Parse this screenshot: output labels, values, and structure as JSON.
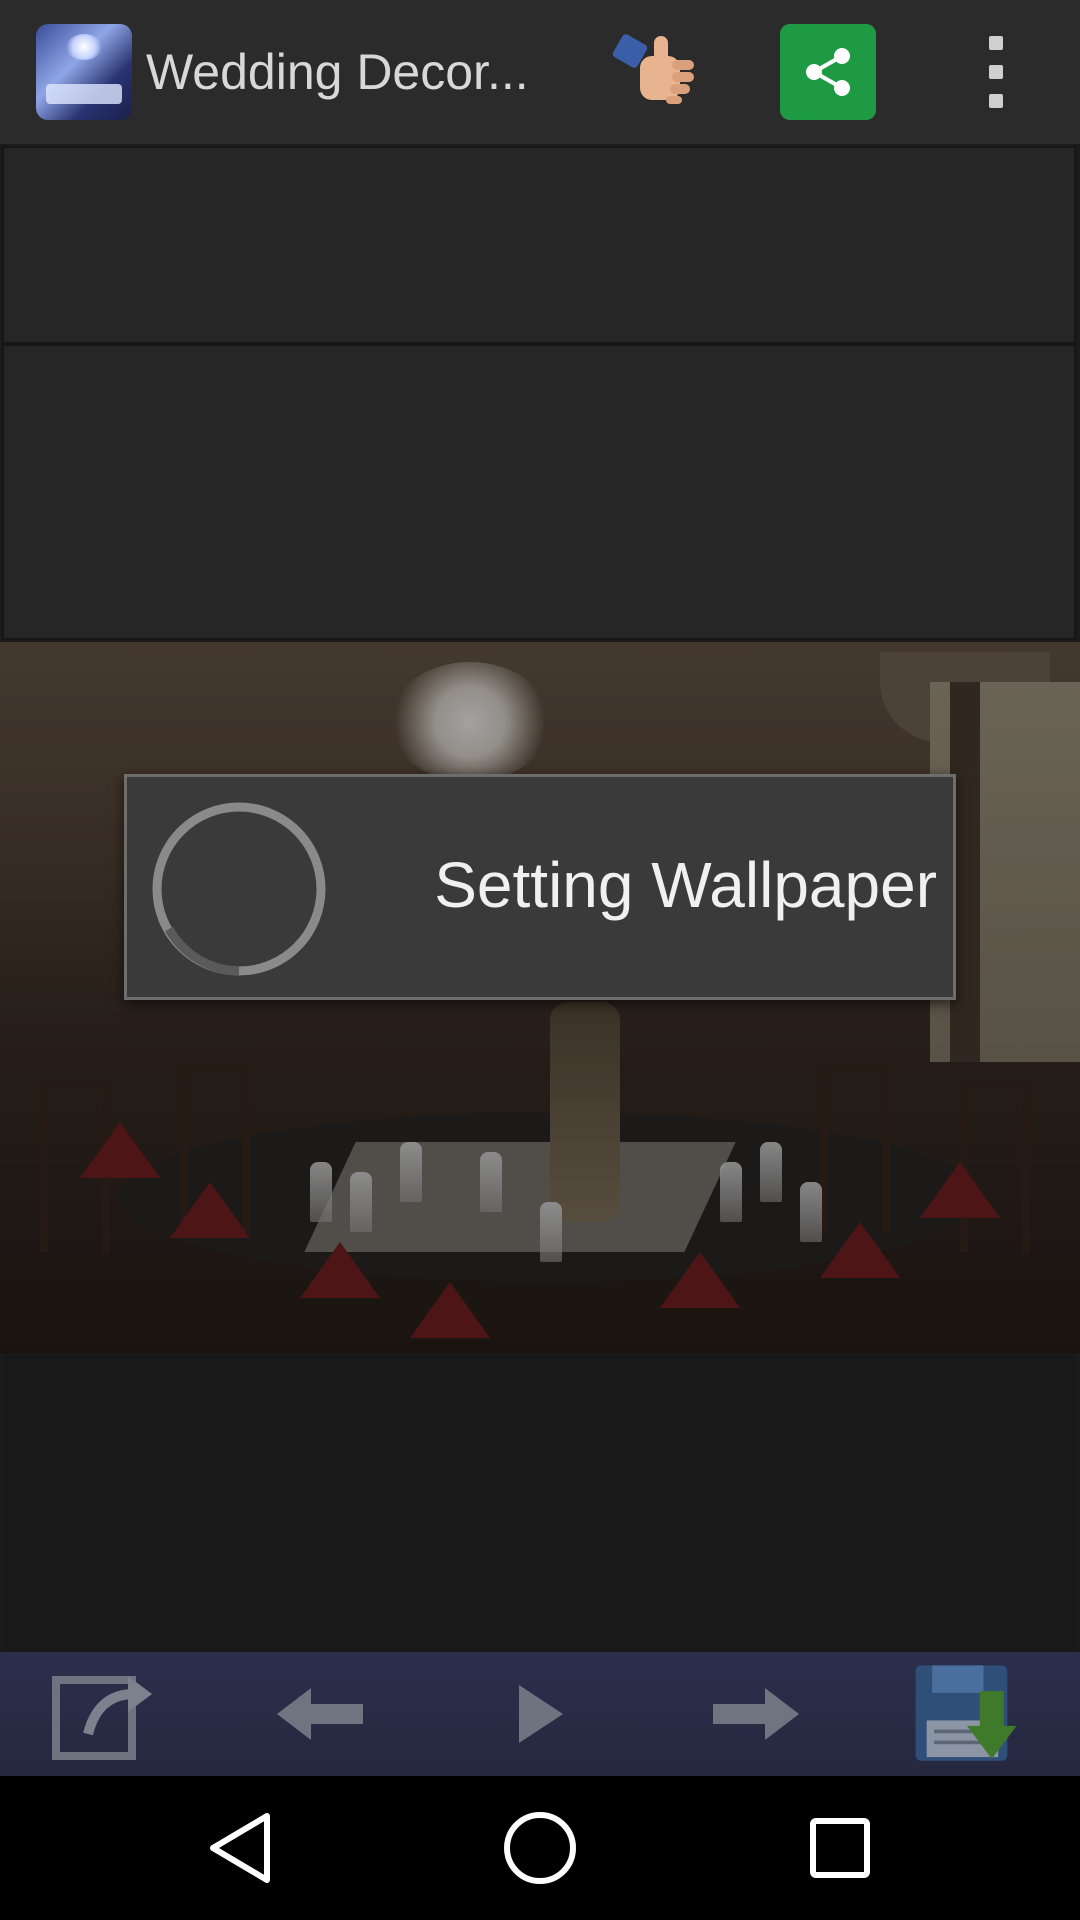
{
  "action_bar": {
    "app_title": "Wedding Decor...",
    "app_icon": "wedding-hall-thumbnail",
    "like_icon": "thumbs-up-icon",
    "share_icon": "share-icon",
    "overflow_icon": "more-vert-icon",
    "share_color": "#1f9a44"
  },
  "dialog": {
    "message": "Setting Wallpaper",
    "spinner_icon": "progress-spinner-icon"
  },
  "toolbar": {
    "buttons": [
      {
        "name": "rotate-button",
        "icon": "rotate-icon"
      },
      {
        "name": "previous-button",
        "icon": "arrow-left-icon"
      },
      {
        "name": "play-button",
        "icon": "play-icon"
      },
      {
        "name": "next-button",
        "icon": "arrow-right-icon"
      },
      {
        "name": "save-button",
        "icon": "floppy-download-icon"
      }
    ],
    "background": "#2c2f4c"
  },
  "system_nav": {
    "back_icon": "back-triangle-icon",
    "home_icon": "home-circle-icon",
    "recents_icon": "recents-square-icon"
  }
}
